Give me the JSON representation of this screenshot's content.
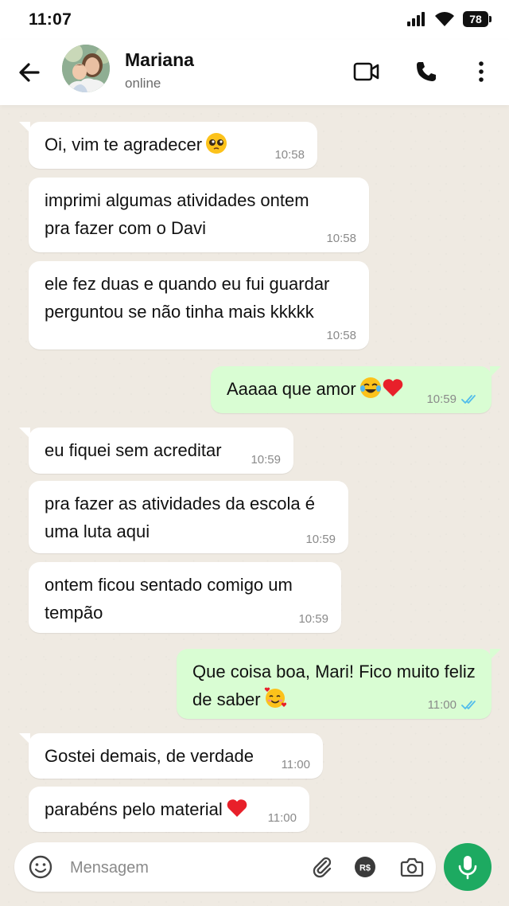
{
  "status_bar": {
    "time": "11:07",
    "battery": "78"
  },
  "header": {
    "name": "Mariana",
    "status": "online"
  },
  "messages": [
    {
      "dir": "in",
      "text": "Oi, vim te agradecer",
      "emoji": "pleading",
      "time": "10:58"
    },
    {
      "dir": "in",
      "text": "imprimi algumas atividades ontem pra fazer com o Davi",
      "time": "10:58"
    },
    {
      "dir": "in",
      "text": "ele fez duas e quando eu fui guardar perguntou se não tinha mais kkkkk",
      "time": "10:58"
    },
    {
      "dir": "out",
      "text": "Aaaaa que amor",
      "emoji": "joy-heart",
      "time": "10:59",
      "read": true
    },
    {
      "dir": "in",
      "text": "eu fiquei sem acreditar",
      "time": "10:59"
    },
    {
      "dir": "in",
      "text": "pra fazer as atividades da escola é uma luta aqui",
      "time": "10:59"
    },
    {
      "dir": "in",
      "text": "ontem ficou sentado comigo um tempão",
      "time": "10:59"
    },
    {
      "dir": "out",
      "text": "Que coisa boa, Mari! Fico muito feliz de saber",
      "emoji": "smiling-hearts",
      "time": "11:00",
      "read": true
    },
    {
      "dir": "in",
      "text": "Gostei demais, de verdade",
      "time": "11:00"
    },
    {
      "dir": "in",
      "text": "parabéns pelo material",
      "emoji": "heart",
      "time": "11:00"
    }
  ],
  "composer": {
    "placeholder": "Mensagem"
  },
  "icons": {
    "back": "back-arrow-icon",
    "video": "video-call-icon",
    "call": "phone-icon",
    "menu": "more-vert-icon",
    "emoji": "emoji-icon",
    "attach": "paperclip-icon",
    "payment": "payment-icon",
    "camera": "camera-icon",
    "mic": "microphone-icon",
    "read_receipt": "double-check-icon"
  },
  "colors": {
    "accent": "#1daa61",
    "outgoing_bubble": "#d9fdd3",
    "incoming_bubble": "#ffffff",
    "read_check": "#53bdeb"
  }
}
